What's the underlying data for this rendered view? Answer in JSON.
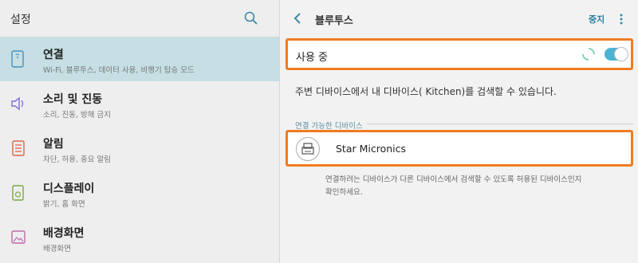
{
  "left_panel": {
    "title": "설정",
    "search_icon": "search-icon",
    "items": [
      {
        "label": "연결",
        "sub": "Wi-Fi, 블루투스, 데이터 사용, 비행기 탑승 모드",
        "icon": "connections-icon",
        "active": true
      },
      {
        "label": "소리 및 진동",
        "sub": "소리, 진동, 방해 금지",
        "icon": "speaker-icon",
        "active": false
      },
      {
        "label": "알림",
        "sub": "차단, 허용, 중요 알림",
        "icon": "notifications-icon",
        "active": false
      },
      {
        "label": "디스플레이",
        "sub": "밝기, 홈 화면",
        "icon": "display-icon",
        "active": false
      },
      {
        "label": "배경화면",
        "sub": "배경화면",
        "icon": "wallpaper-icon",
        "active": false
      }
    ]
  },
  "right_panel": {
    "title": "블루투스",
    "back_icon": "back-arrow-icon",
    "stop_label": "중지",
    "more_icon": "more-vert-icon",
    "toggle": {
      "label": "사용 중",
      "state": "on"
    },
    "description": "주변 디바이스에서 내 디바이스(      Kitchen)를 검색할 수 있습니다.",
    "section_label": "연결 가능한 디바이스",
    "device": {
      "name": "Star Micronics",
      "icon": "printer-icon"
    },
    "note": "연결하려는 디바이스가 다른 디바이스에서 검색할 수 있도록 허용된 디바이스인지 확인하세요."
  },
  "colors": {
    "accent": "#4bb3d4",
    "highlight_border": "#ef7c22",
    "active_item_bg": "#c5dfe4"
  }
}
